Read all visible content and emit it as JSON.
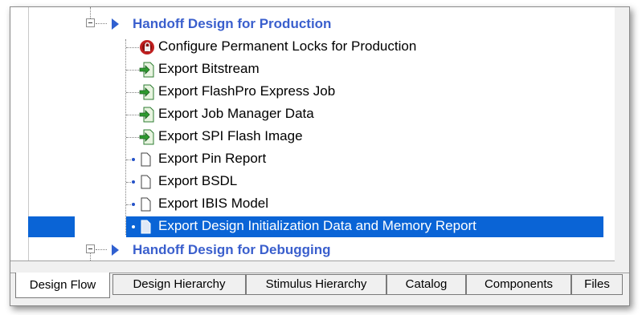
{
  "tree": {
    "groups": [
      {
        "label": "Handoff Design for Production"
      },
      {
        "label": "Handoff Design for Debugging"
      }
    ],
    "items": [
      {
        "label": "Configure Permanent Locks for Production",
        "icon": "lock-gear-icon"
      },
      {
        "label": "Export Bitstream",
        "icon": "export-arrow-icon"
      },
      {
        "label": "Export FlashPro Express Job",
        "icon": "export-arrow-icon"
      },
      {
        "label": "Export Job Manager Data",
        "icon": "export-arrow-icon"
      },
      {
        "label": "Export SPI Flash Image",
        "icon": "export-arrow-icon"
      },
      {
        "label": "Export Pin Report",
        "icon": "document-icon"
      },
      {
        "label": "Export BSDL",
        "icon": "document-icon"
      },
      {
        "label": "Export IBIS Model",
        "icon": "document-icon"
      },
      {
        "label": "Export Design Initialization Data and Memory Report",
        "icon": "document-icon",
        "selected": true
      }
    ]
  },
  "tabs": [
    {
      "label": "Design Flow",
      "active": true
    },
    {
      "label": "Design Hierarchy"
    },
    {
      "label": "Stimulus Hierarchy"
    },
    {
      "label": "Catalog"
    },
    {
      "label": "Components"
    },
    {
      "label": "Files"
    }
  ],
  "colors": {
    "group_text": "#3a5fcd",
    "selection": "#0a64d6"
  }
}
